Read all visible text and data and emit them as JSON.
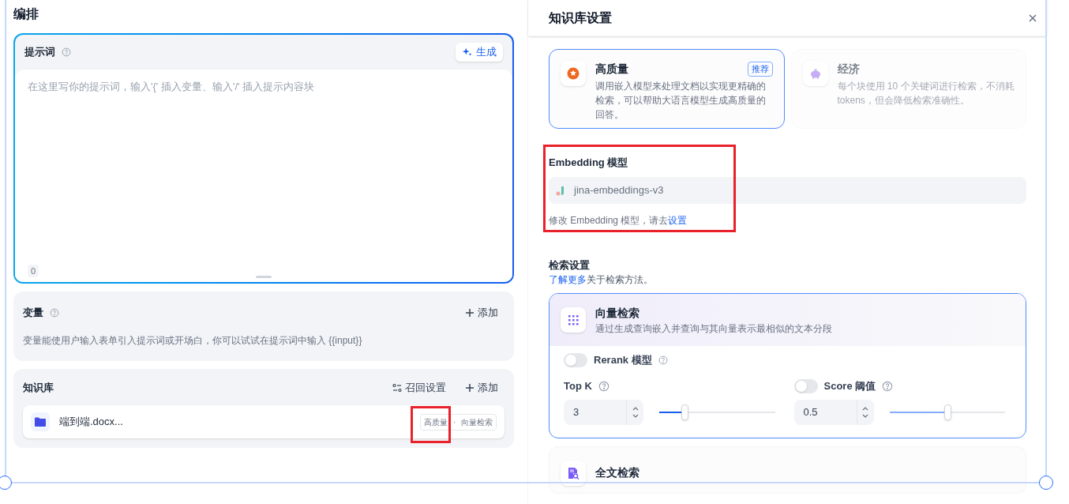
{
  "orchestration": {
    "title": "编排",
    "prompt": {
      "title": "提示词",
      "generate_button": "生成",
      "placeholder": "在这里写你的提示词，输入'{' 插入变量、输入'/' 插入提示内容块",
      "char_count": "0"
    },
    "variables": {
      "title": "变量",
      "add_button": "添加",
      "description": "变量能使用户输入表单引入提示词或开场白，你可以试试在提示词中输入 {{input}}"
    },
    "knowledge": {
      "title": "知识库",
      "recall_button": "召回设置",
      "add_button": "添加",
      "items": [
        {
          "name": "端到端.docx...",
          "tag": "高质量 · 向量检索"
        }
      ]
    }
  },
  "settings": {
    "title": "知识库设置",
    "index_modes": [
      {
        "kind": "quality",
        "name": "高质量",
        "badge": "推荐",
        "description": "调用嵌入模型来处理文档以实现更精确的检索，可以帮助大语言模型生成高质量的回答。",
        "selected": true
      },
      {
        "kind": "economy",
        "name": "经济",
        "description": "每个块使用 10 个关键词进行检索，不消耗 tokens，但会降低检索准确性。",
        "selected": false
      }
    ],
    "embedding": {
      "label": "Embedding 模型",
      "model": "jina-embeddings-v3",
      "note": "修改 Embedding 模型，请去",
      "note_link": "设置"
    },
    "retrieval": {
      "title": "检索设置",
      "link": "了解更多",
      "link_suffix": "关于检索方法。",
      "methods": [
        {
          "kind": "vector",
          "name": "向量检索",
          "description": "通过生成查询嵌入并查询与其向量表示最相似的文本分段",
          "selected": true
        },
        {
          "kind": "fulltext",
          "name": "全文检索",
          "selected": false
        }
      ],
      "rerank": {
        "label": "Rerank 模型",
        "on": false
      },
      "top_k": {
        "label": "Top K",
        "value": "3",
        "level": 0.22
      },
      "score": {
        "label": "Score 阈值",
        "on": false,
        "value": "0.5",
        "level": 0.5
      }
    }
  }
}
